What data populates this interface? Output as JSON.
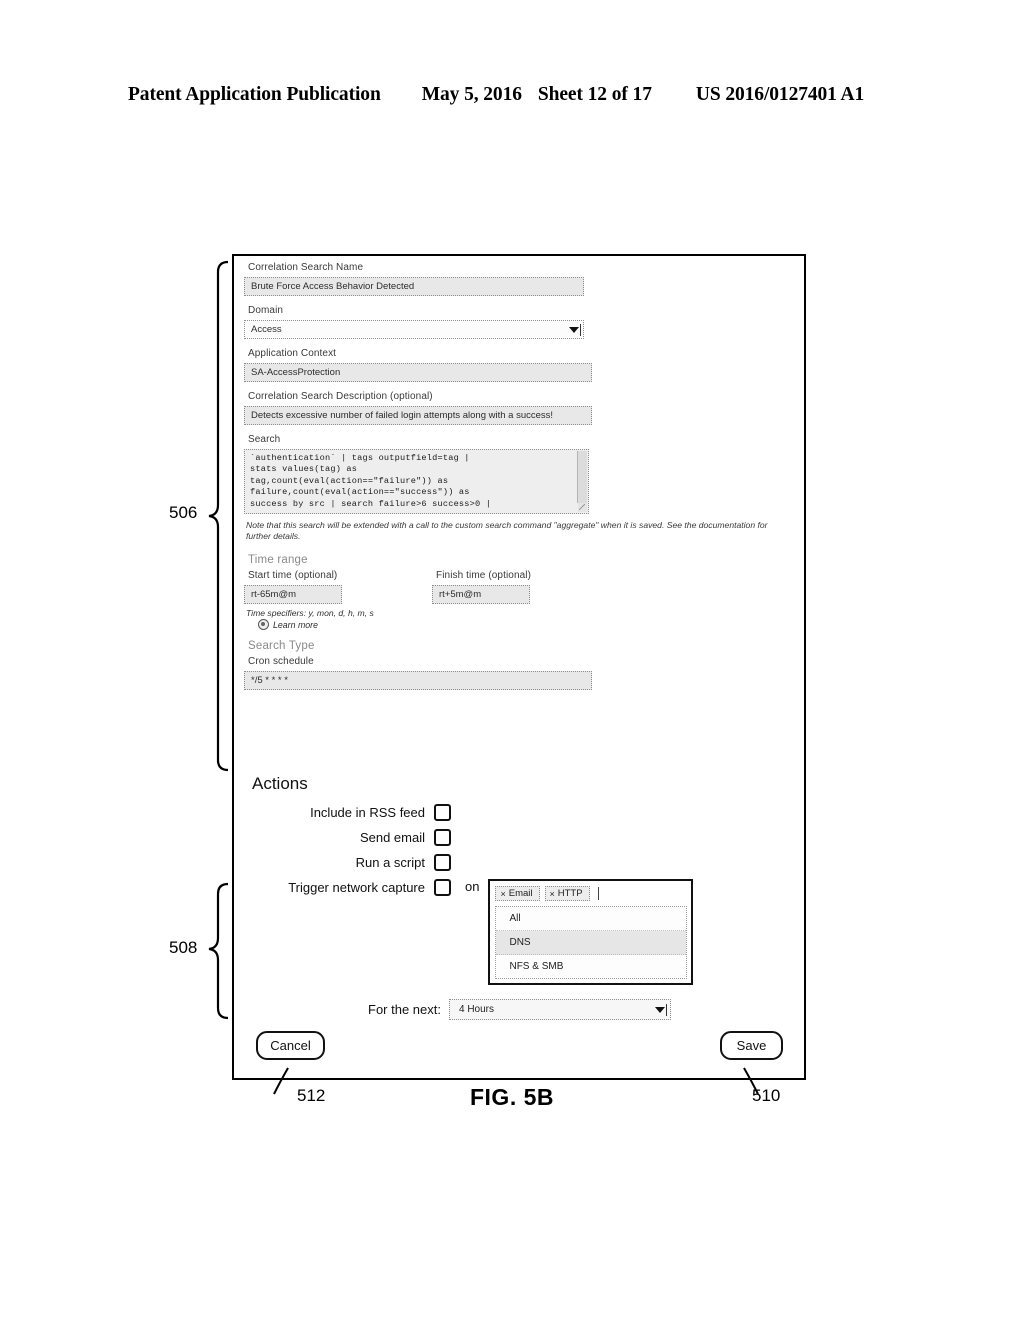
{
  "header": {
    "publication": "Patent Application Publication",
    "date": "May 5, 2016",
    "sheet": "Sheet 12 of 17",
    "number": "US 2016/0127401 A1"
  },
  "figure": {
    "caption": "FIG. 5B",
    "refs": {
      "form_section": "506",
      "actions_section": "508",
      "save_button": "510",
      "cancel_button": "512"
    }
  },
  "form": {
    "name_label": "Correlation Search Name",
    "name_value": "Brute Force Access Behavior Detected",
    "domain_label": "Domain",
    "domain_value": "Access",
    "app_context_label": "Application Context",
    "app_context_value": "SA-AccessProtection",
    "description_label": "Correlation Search Description (optional)",
    "description_value": "Detects excessive number of failed login attempts along with a success!",
    "search_label": "Search",
    "search_value": "`authentication` | tags outputfield=tag |\nstats values(tag) as\ntag,count(eval(action==\"failure\")) as\nfailure,count(eval(action==\"success\")) as\nsuccess by src | search failure>6 success>0 |",
    "note": "Note that this search will be extended with a call to the custom search command \"aggregate\" when it is saved. See the documentation for further details.",
    "time_range_heading": "Time range",
    "start_time_label": "Start time (optional)",
    "start_time_value": "rt-65m@m",
    "finish_time_label": "Finish time (optional)",
    "finish_time_value": "rt+5m@m",
    "time_specifiers": "Time specifiers: y, mon, d, h, m, s",
    "learn_more": "Learn more",
    "search_type_heading": "Search Type",
    "cron_label": "Cron schedule",
    "cron_value": "*/5 * * * *"
  },
  "actions": {
    "title": "Actions",
    "items": [
      {
        "label": "Include in RSS feed",
        "checked": false
      },
      {
        "label": "Send email",
        "checked": false
      },
      {
        "label": "Run a script",
        "checked": false
      },
      {
        "label": "Trigger network capture",
        "checked": false
      }
    ],
    "on_word": "on",
    "capture_tokens": [
      {
        "remove": "×",
        "label": "Email"
      },
      {
        "remove": "×",
        "label": "HTTP"
      }
    ],
    "capture_options": [
      "All",
      "DNS",
      "NFS & SMB"
    ],
    "duration_label": "For the next:",
    "duration_value": "4 Hours"
  },
  "buttons": {
    "cancel": "Cancel",
    "save": "Save"
  }
}
